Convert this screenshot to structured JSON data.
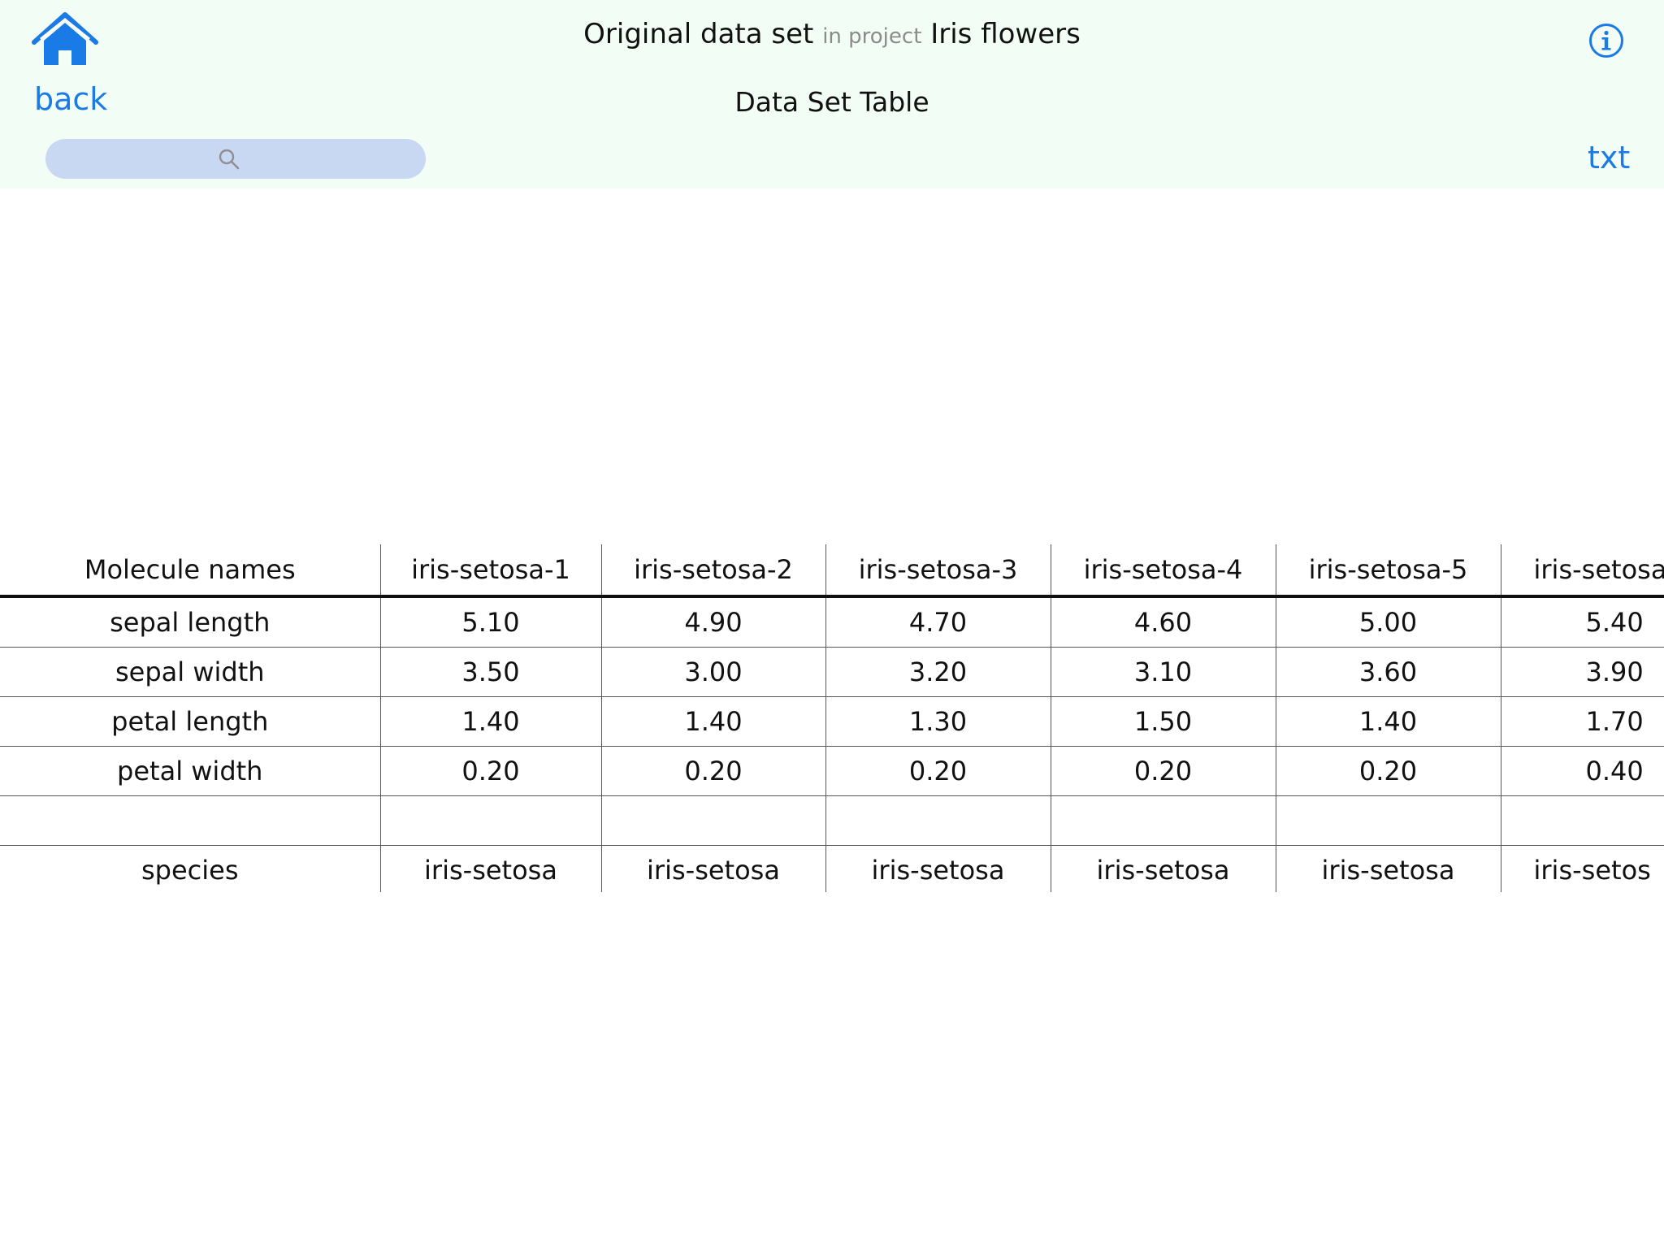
{
  "header": {
    "title_main": "Original data set",
    "title_connector": "in project",
    "project_name": "Iris flowers",
    "subtitle": "Data Set Table",
    "back_label": "back",
    "export_label": "txt",
    "icons": {
      "home": "home-icon",
      "info": "info-icon",
      "search": "search-icon"
    },
    "accent_color": "#1a7ae6",
    "header_background": "#f2fdf5",
    "search_background": "#c9d8f2"
  },
  "search": {
    "value": "",
    "placeholder": ""
  },
  "table": {
    "columns": [
      "Molecule names",
      "iris-setosa-1",
      "iris-setosa-2",
      "iris-setosa-3",
      "iris-setosa-4",
      "iris-setosa-5",
      "iris-setosa"
    ],
    "rows": [
      [
        "sepal length",
        "5.10",
        "4.90",
        "4.70",
        "4.60",
        "5.00",
        "5.40"
      ],
      [
        "sepal width",
        "3.50",
        "3.00",
        "3.20",
        "3.10",
        "3.60",
        "3.90"
      ],
      [
        "petal length",
        "1.40",
        "1.40",
        "1.30",
        "1.50",
        "1.40",
        "1.70"
      ],
      [
        "petal width",
        "0.20",
        "0.20",
        "0.20",
        "0.20",
        "0.20",
        "0.40"
      ],
      [
        "",
        "",
        "",
        "",
        "",
        "",
        ""
      ],
      [
        "species",
        "iris-setosa",
        "iris-setosa",
        "iris-setosa",
        "iris-setosa",
        "iris-setosa",
        "iris-setos"
      ]
    ]
  }
}
